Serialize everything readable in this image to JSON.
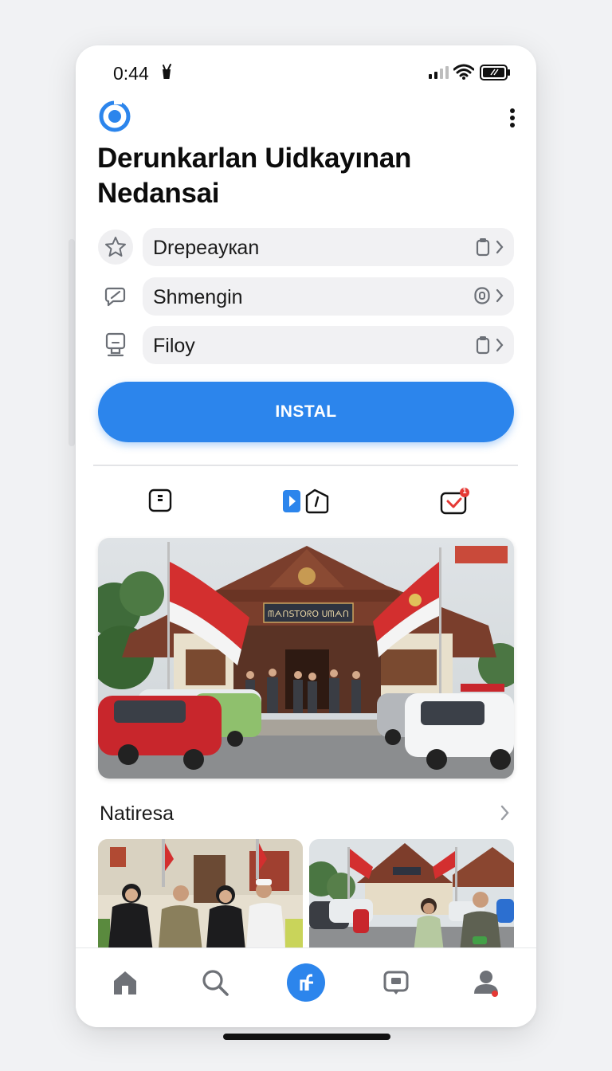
{
  "status_bar": {
    "time": "0:44"
  },
  "header": {
    "title": "Derunkarlan Uidkayınan Nedansai"
  },
  "menu": {
    "items": [
      {
        "label": "Drepeayкan",
        "icon": "star-icon"
      },
      {
        "label": "Shmengin",
        "icon": "edit-icon"
      },
      {
        "label": "Filoy",
        "icon": "file-icon"
      }
    ]
  },
  "actions": {
    "install_label": "INSTAL"
  },
  "tabs": {
    "notification_badge": "1"
  },
  "photo_banner": {
    "sign_text": "ᗰᗅᑎSTOᖇO  ᑌᗰᗅᑎ"
  },
  "section": {
    "title": "Natiresa"
  },
  "colors": {
    "accent": "#2c85ec",
    "badge": "#e53935",
    "flag_red": "#d32f2f"
  }
}
